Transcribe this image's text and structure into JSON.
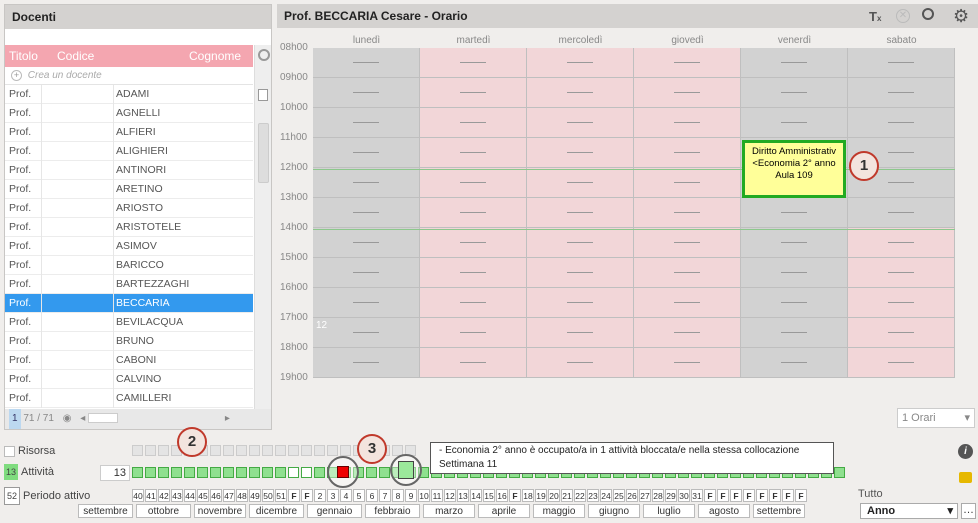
{
  "left_panel": {
    "title": "Docenti",
    "columns": [
      "Titolo",
      "Codice",
      "Cognome"
    ],
    "add_placeholder": "Crea un docente",
    "rows": [
      {
        "title": "Prof.",
        "name": "ADAMI"
      },
      {
        "title": "Prof.",
        "name": "AGNELLI"
      },
      {
        "title": "Prof.",
        "name": "ALFIERI"
      },
      {
        "title": "Prof.",
        "name": "ALIGHIERI"
      },
      {
        "title": "Prof.",
        "name": "ANTINORI"
      },
      {
        "title": "Prof.",
        "name": "ARETINO"
      },
      {
        "title": "Prof.",
        "name": "ARIOSTO"
      },
      {
        "title": "Prof.",
        "name": "ARISTOTELE"
      },
      {
        "title": "Prof.",
        "name": "ASIMOV"
      },
      {
        "title": "Prof.",
        "name": "BARICCO"
      },
      {
        "title": "Prof.",
        "name": "BARTEZZAGHI"
      },
      {
        "title": "Prof.",
        "name": "BECCARIA",
        "selected": true
      },
      {
        "title": "Prof.",
        "name": "BEVILACQUA"
      },
      {
        "title": "Prof.",
        "name": "BRUNO"
      },
      {
        "title": "Prof.",
        "name": "CABONI"
      },
      {
        "title": "Prof.",
        "name": "CALVINO"
      },
      {
        "title": "Prof.",
        "name": "CAMILLERI"
      }
    ],
    "footer_page": "1",
    "footer_count": "71 / 71"
  },
  "right_panel": {
    "title": "Prof. BECCARIA Cesare - Orario",
    "days": [
      "lunedì",
      "martedì",
      "mercoledì",
      "giovedì",
      "venerdì",
      "sabato"
    ],
    "hours": [
      "08h00",
      "09h00",
      "10h00",
      "11h00",
      "12h00",
      "13h00",
      "14h00",
      "15h00",
      "16h00",
      "17h00",
      "18h00",
      "19h00"
    ],
    "cell_note": "12",
    "course": {
      "line1": "Diritto Amministrativ",
      "line2": "<Economia 2° anno",
      "line3": "Aula 109"
    },
    "orari_select": "1 Orari"
  },
  "bottom": {
    "risorsa_label": "Risorsa",
    "attivita_count": "13",
    "attivita_label": "Attività",
    "attivita_value": "13",
    "periodo_count": "52",
    "periodo_label": "Periodo attivo",
    "weeks": [
      "40",
      "41",
      "42",
      "43",
      "44",
      "45",
      "46",
      "47",
      "48",
      "49",
      "50",
      "51",
      "F",
      "F",
      "2",
      "3",
      "4",
      "5",
      "6",
      "7",
      "8",
      "9",
      "10",
      "11",
      "12",
      "13",
      "14",
      "15",
      "16",
      "F",
      "18",
      "19",
      "20",
      "21",
      "22",
      "23",
      "24",
      "25",
      "26",
      "27",
      "28",
      "29",
      "30",
      "31",
      "F",
      "F",
      "F",
      "F",
      "F",
      "F",
      "F",
      "F"
    ],
    "months": [
      "settembre",
      "ottobre",
      "novembre",
      "dicembre",
      "gennaio",
      "febbraio",
      "marzo",
      "aprile",
      "maggio",
      "giugno",
      "luglio",
      "agosto",
      "settembre"
    ],
    "tutto_label": "Tutto",
    "anno_select": "Anno",
    "tooltip_line1": "- Economia 2° anno è occupato/a in 1 attività bloccata/e nella stessa collocazione",
    "tooltip_line2": "Settimana 11"
  },
  "badges": [
    "1",
    "2",
    "3"
  ],
  "colors": {
    "selected_row": "#3399ee",
    "header_pink": "#f4a6b0",
    "course_border": "#22aa22",
    "course_bg": "#ffff99",
    "badge_border": "#c0392b"
  }
}
